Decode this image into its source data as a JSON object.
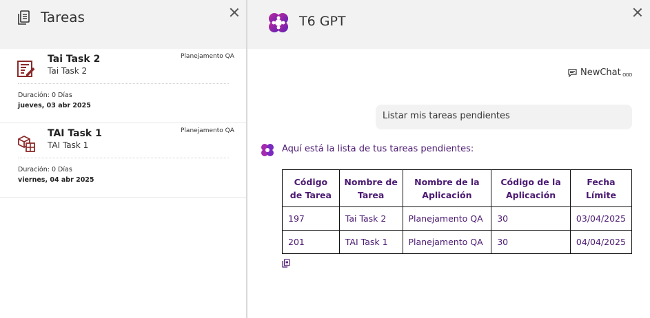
{
  "left_panel": {
    "title": "Tareas",
    "tasks": [
      {
        "title": "Tai Task 2",
        "subtitle": "Tai Task 2",
        "app": "Planejamento QA",
        "duration": "Duración: 0 Días",
        "date": "jueves, 03 abr 2025",
        "icon": "edit-form-icon"
      },
      {
        "title": "TAI Task 1",
        "subtitle": "TAI Task 1",
        "app": "Planejamento QA",
        "duration": "Duración: 0 Días",
        "date": "viernes, 04 abr 2025",
        "icon": "cubes-icon"
      }
    ]
  },
  "right_panel": {
    "title": "T6 GPT",
    "newchat_label": "NewChat",
    "more_label": "ooo",
    "user_message": "Listar mis tareas pendientes",
    "bot_message": "Aquí está la lista de tus tareas pendientes:",
    "table": {
      "headers": [
        "Código de Tarea",
        "Nombre de Tarea",
        "Nombre de la Aplicación",
        "Código de la Aplicación",
        "Fecha Límite"
      ],
      "rows": [
        [
          "197",
          "Tai Task 2",
          "Planejamento QA",
          "30",
          "03/04/2025"
        ],
        [
          "201",
          "TAI Task 1",
          "Planejamento QA",
          "30",
          "04/04/2025"
        ]
      ]
    }
  },
  "colors": {
    "accent_purple": "#4b1a72",
    "task_icon": "#8b2a2a",
    "header_bg": "#f2f2f2"
  }
}
